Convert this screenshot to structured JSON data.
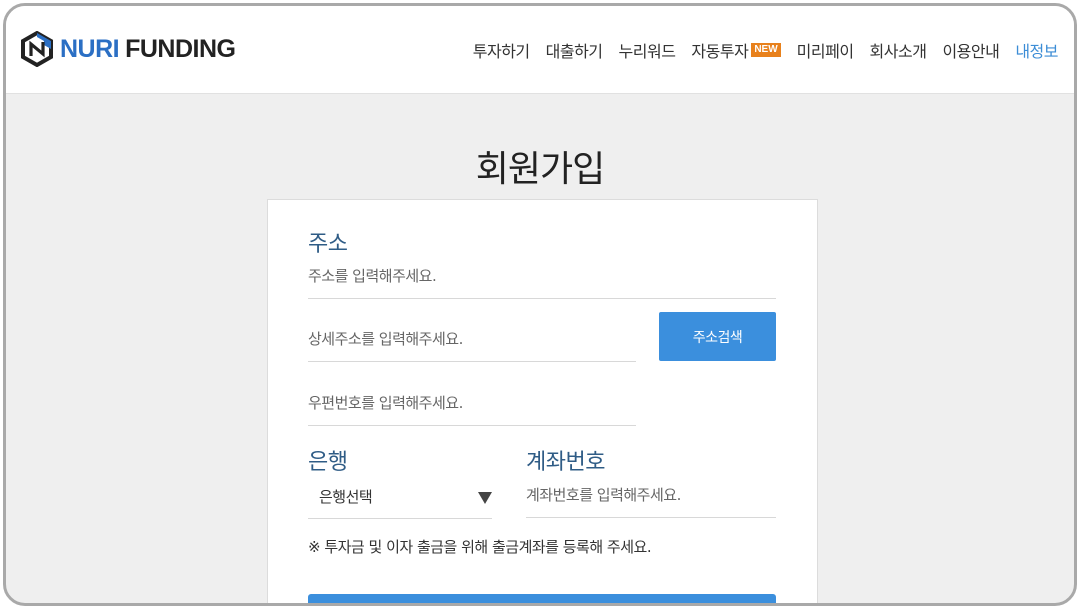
{
  "brand": {
    "name_part1": "NURI",
    "name_part2": "FUNDING",
    "logo_icon": "hexagon-n-logo-icon",
    "colors": {
      "primary": "#2b6fc4",
      "dark": "#222222"
    }
  },
  "nav": {
    "items": [
      {
        "label": "투자하기",
        "active": false
      },
      {
        "label": "대출하기",
        "active": false
      },
      {
        "label": "누리워드",
        "active": false
      },
      {
        "label": "자동투자",
        "active": false,
        "badge": "NEW"
      },
      {
        "label": "미리페이",
        "active": false
      },
      {
        "label": "회사소개",
        "active": false
      },
      {
        "label": "이용안내",
        "active": false
      },
      {
        "label": "내정보",
        "active": true
      }
    ],
    "active_color": "#3c8dd6",
    "badge_color": "#e8811c"
  },
  "page": {
    "title": "회원가입"
  },
  "form": {
    "address": {
      "label": "주소",
      "address_placeholder": "주소를 입력해주세요.",
      "detail_placeholder": "상세주소를 입력해주세요.",
      "zip_placeholder": "우편번호를 입력해주세요.",
      "search_button": "주소검색"
    },
    "bank": {
      "label": "은행",
      "selected": "은행선택"
    },
    "account": {
      "label": "계좌번호",
      "placeholder": "계좌번호를 입력해주세요."
    },
    "notice": "※ 투자금 및 이자 출금을 위해 출금계좌를 등록해 주세요.",
    "accent_color": "#3b8fdd",
    "label_color": "#2f5c86"
  }
}
